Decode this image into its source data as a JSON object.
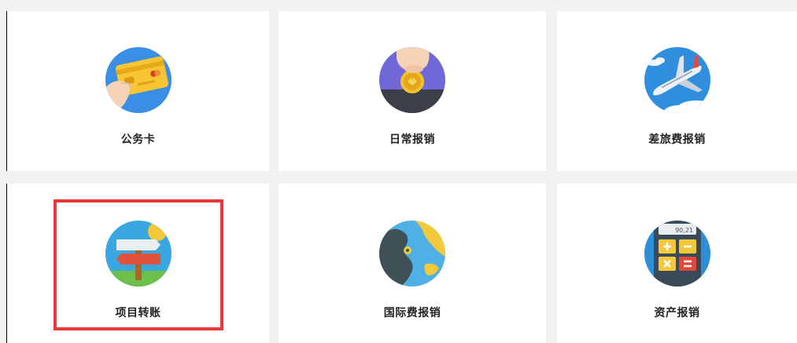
{
  "cards": [
    {
      "label": "公务卡",
      "icon": "corporate-card-icon"
    },
    {
      "label": "日常报销",
      "icon": "coin-hand-icon"
    },
    {
      "label": "差旅费报销",
      "icon": "airplane-icon"
    },
    {
      "label": "项目转账",
      "icon": "signpost-icon"
    },
    {
      "label": "国际费报销",
      "icon": "globe-icon"
    },
    {
      "label": "资产报销",
      "icon": "calculator-icon"
    }
  ],
  "calculator_display": "90,21",
  "highlighted_card": "项目转账",
  "colors": {
    "background": "#f2f2f2",
    "card": "#ffffff",
    "highlight": "#e8393a",
    "text": "#222222"
  }
}
